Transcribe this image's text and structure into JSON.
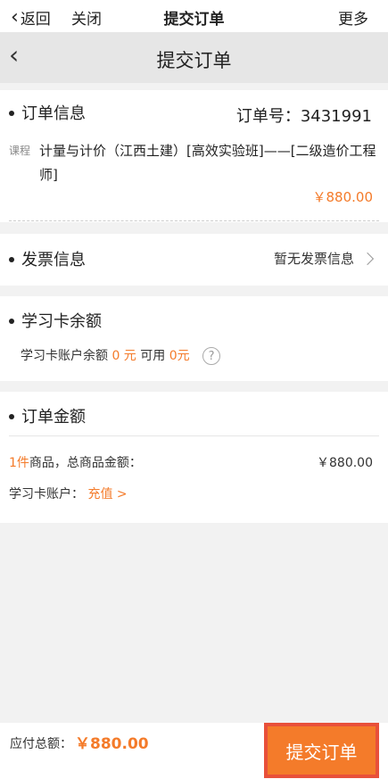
{
  "topbar": {
    "back_label": "返回",
    "close_label": "关闭",
    "title": "提交订单",
    "more_label": "更多"
  },
  "navbar": {
    "title": "提交订单"
  },
  "order_info": {
    "title": "订单信息",
    "order_no": "订单号：3431991",
    "course_tag": "课程",
    "course_name": "计量与计价（江西土建）[高效实验班]——[二级造价工程师]",
    "price": "￥880.00"
  },
  "invoice": {
    "title": "发票信息",
    "value": "暂无发票信息"
  },
  "study_card": {
    "title": "学习卡余额",
    "balance_label": "学习卡账户余额",
    "balance_value": "0 元",
    "available_label": "可用",
    "available_value": "0元"
  },
  "amount": {
    "title": "订单金额",
    "count": "1件",
    "goods_label": "商品，总商品金额：",
    "goods_total": "￥880.00",
    "card_account_label": "学习卡账户：",
    "recharge_label": "充值 >"
  },
  "footer": {
    "due_label": "应付总额：",
    "due_value": "￥880.00",
    "submit_label": "提交订单"
  },
  "colors": {
    "accent": "#f47b2a",
    "highlight_border": "#e8503a"
  }
}
